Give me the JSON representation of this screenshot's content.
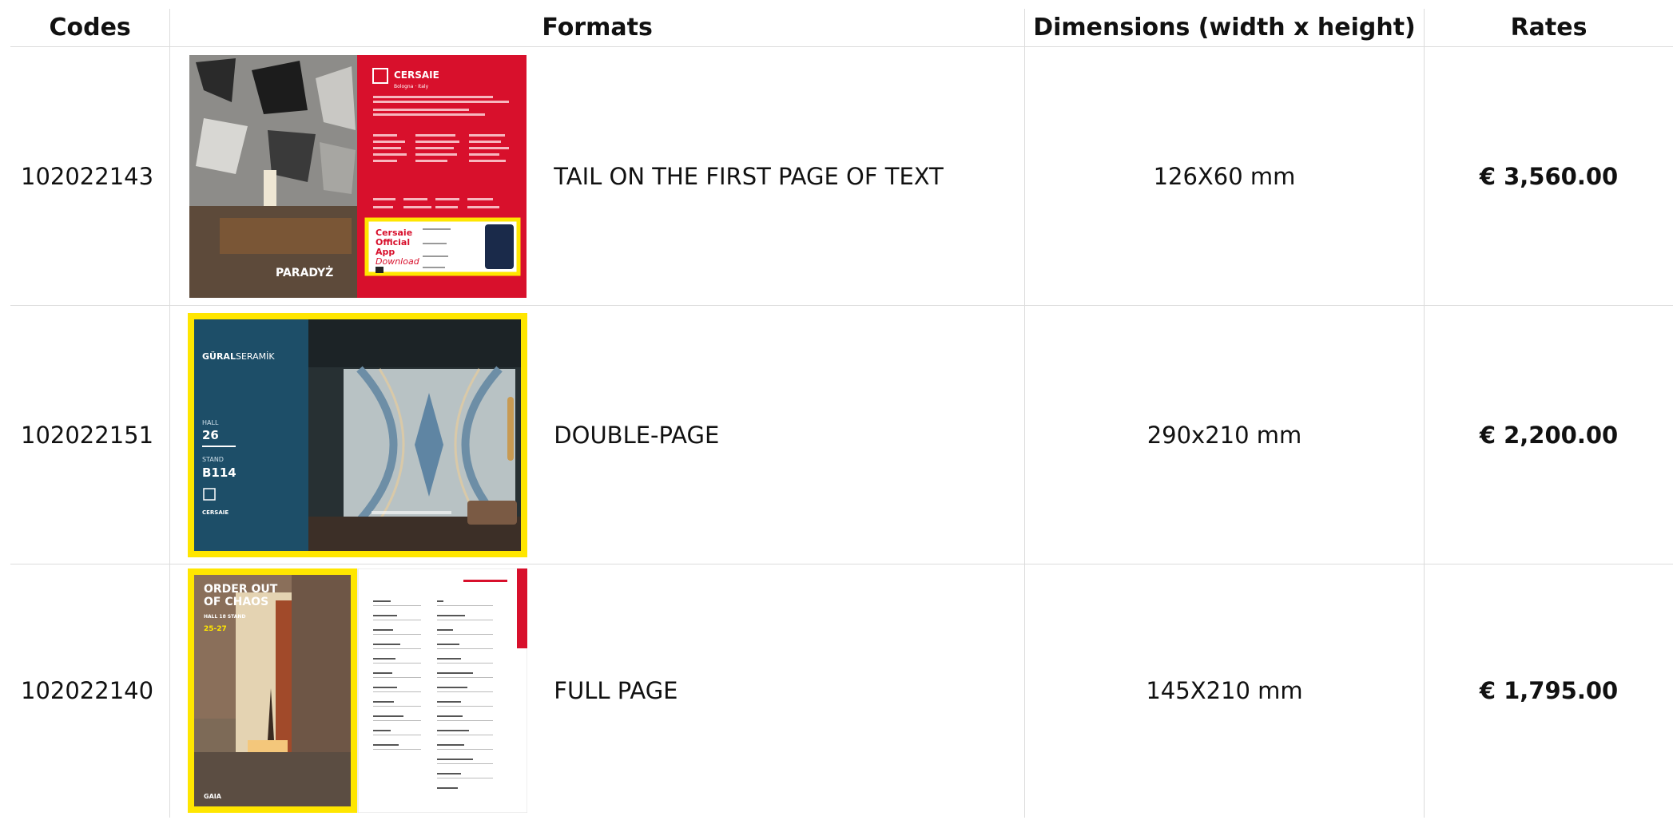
{
  "table": {
    "headers": {
      "code": "Codes",
      "format": "Formats",
      "dimensions": "Dimensions (width x height)",
      "rate": "Rates"
    },
    "rows": [
      {
        "code": "102022143",
        "format": "TAIL ON THE FIRST PAGE OF TEXT",
        "dimensions": "126X60 mm",
        "rate": "€ 3,560.00",
        "thumbnail": {
          "brand": "CERSAIE",
          "brand_sub": "Bologna · Italy",
          "exhibitor": "PARADYŻ",
          "app_banner": [
            "Cersaie",
            "Official",
            "App",
            "Download"
          ]
        }
      },
      {
        "code": "102022151",
        "format": "DOUBLE-PAGE",
        "dimensions": "290x210 mm",
        "rate": "€ 2,200.00",
        "thumbnail": {
          "brand_bold": "GÜRAL",
          "brand_light": "SERAMİK",
          "hall_label": "HALL",
          "hall": "26",
          "stand_label": "STAND",
          "stand": "B114",
          "footer": "CERSAIE"
        }
      },
      {
        "code": "102022140",
        "format": "FULL PAGE",
        "dimensions": "145X210 mm",
        "rate": "€ 1,795.00",
        "thumbnail": {
          "headline_1": "ORDER OUT",
          "headline_2": "OF CHAOS",
          "sub": "HALL 18 STAND",
          "dates": "25-27",
          "logo": "GAIA"
        }
      }
    ]
  },
  "colors": {
    "cersaie_red": "#d8102c",
    "highlight_yellow": "#ffe600",
    "teal_panel": "#1d4e68"
  }
}
